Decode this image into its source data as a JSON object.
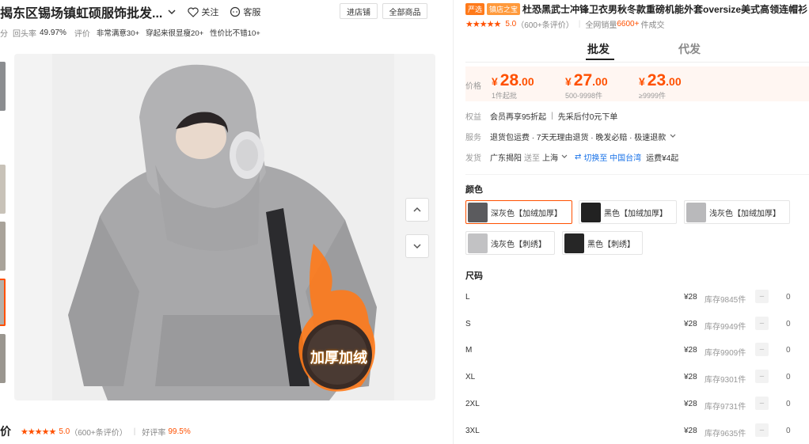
{
  "shop": {
    "name": "揭东区锡场镇虹硕服饰批发...",
    "follow_label": "关注",
    "service_label": "客服",
    "enter_shop_label": "进店铺",
    "all_products_label": "全部商品"
  },
  "stats": {
    "cut_prefix": "分",
    "return_rate_label": "回头率",
    "return_rate_value": "49.97%",
    "review_label": "评价",
    "tags": [
      "非常满意30+",
      "穿起来很显瘦20+",
      "性价比不错10+"
    ]
  },
  "gallery": {
    "image_alt": "灰色连帽加厚卫衣",
    "overlay_text": "加厚加绒",
    "prev_icon": "chevron-up-icon",
    "next_icon": "chevron-down-icon"
  },
  "reviews": {
    "title_fragment": "价",
    "score": "5.0",
    "count": "（600+条评价）",
    "good_rate_label": "好评率",
    "good_rate_value": "99.5%"
  },
  "product": {
    "badges": [
      {
        "text": "严选",
        "color": "#ff7a1a"
      },
      {
        "text": "镇店之宝",
        "color": "#ff9a3c"
      }
    ],
    "title": "杜恐黑武士冲锋卫衣男秋冬款重磅机能外套oversize美式高领连帽衫",
    "score": "5.0",
    "review_count": "（600+条评价）",
    "sales_prefix": "全网销量",
    "sales_value": "6600+",
    "sales_suffix": "件成交"
  },
  "tabs": [
    {
      "label": "批发",
      "active": true
    },
    {
      "label": "代发",
      "active": false
    }
  ],
  "price": {
    "label": "价格",
    "tiers": [
      {
        "currency": "¥",
        "int": "28",
        "dec": ".00",
        "qty": "1件起批"
      },
      {
        "currency": "¥",
        "int": "27",
        "dec": ".00",
        "qty": "500-9998件"
      },
      {
        "currency": "¥",
        "int": "23",
        "dec": ".00",
        "qty": "≥9999件"
      }
    ]
  },
  "benefits": {
    "label": "权益",
    "items": [
      "会员再享95折起",
      "先采后付0元下单"
    ]
  },
  "services": {
    "label": "服务",
    "text": "退货包运费 · 7天无理由退货 · 晚发必赔 · 极速退款"
  },
  "shipping": {
    "label": "发货",
    "origin": "广东揭阳",
    "to_label": "送至",
    "destination": "上海",
    "switch_label": "切换至 中国台湾",
    "fee": "运费¥4起"
  },
  "colors": {
    "title": "颜色",
    "options": [
      {
        "label": "深灰色【加绒加厚】",
        "selected": true
      },
      {
        "label": "黑色【加绒加厚】",
        "selected": false
      },
      {
        "label": "浅灰色【加绒加厚】",
        "selected": false
      },
      {
        "label": "浅灰色【刺绣】",
        "selected": false
      },
      {
        "label": "黑色【刺绣】",
        "selected": false
      }
    ]
  },
  "sizes": {
    "title": "尺码",
    "rows": [
      {
        "size": "L",
        "price": "¥28",
        "stock": "库存9845件",
        "qty": "0"
      },
      {
        "size": "S",
        "price": "¥28",
        "stock": "库存9949件",
        "qty": "0"
      },
      {
        "size": "M",
        "price": "¥28",
        "stock": "库存9909件",
        "qty": "0"
      },
      {
        "size": "XL",
        "price": "¥28",
        "stock": "库存9301件",
        "qty": "0"
      },
      {
        "size": "2XL",
        "price": "¥28",
        "stock": "库存9731件",
        "qty": "0"
      },
      {
        "size": "3XL",
        "price": "¥28",
        "stock": "库存9635件",
        "qty": "0"
      }
    ]
  }
}
